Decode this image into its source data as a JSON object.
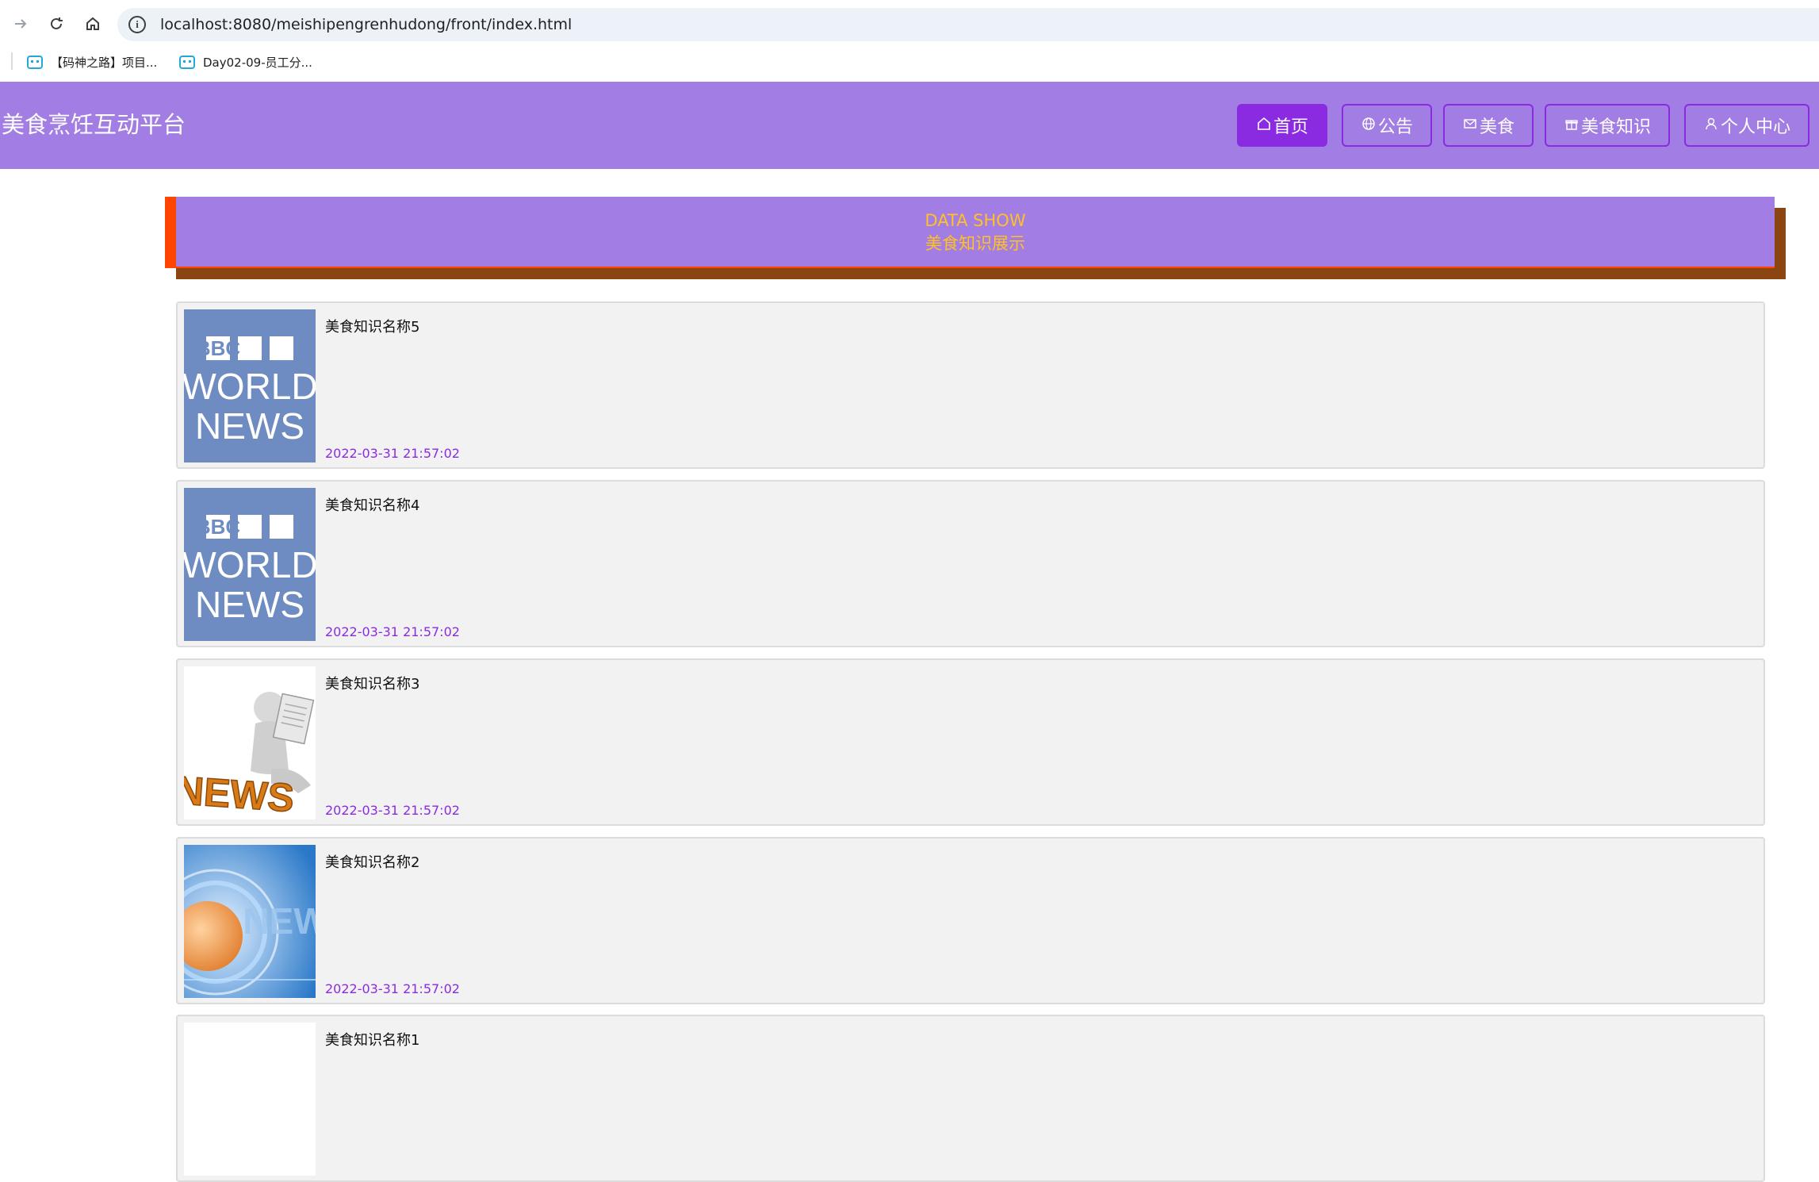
{
  "browser": {
    "url": "localhost:8080/meishipengrenhudong/front/index.html",
    "bookmarks": [
      {
        "label": "【码神之路】项目..."
      },
      {
        "label": "Day02-09-员工分..."
      }
    ]
  },
  "header": {
    "title": "美食烹饪互动平台",
    "nav": [
      {
        "label": "首页",
        "icon": "home-icon"
      },
      {
        "label": "公告",
        "icon": "globe-icon"
      },
      {
        "label": "美食",
        "icon": "mail-icon"
      },
      {
        "label": "美食知识",
        "icon": "gift-icon"
      },
      {
        "label": "个人中心",
        "icon": "user-icon"
      }
    ]
  },
  "banner": {
    "en": "DATA SHOW",
    "cn": "美食知识展示"
  },
  "items": [
    {
      "title": "美食知识名称5",
      "date": "2022-03-31 21:57:02",
      "thumb": "bbc-world-news",
      "thumb_text": [
        "BBC",
        "WORLD",
        "NEWS"
      ]
    },
    {
      "title": "美食知识名称4",
      "date": "2022-03-31 21:57:02",
      "thumb": "bbc-world-news",
      "thumb_text": [
        "BBC",
        "WORLD",
        "NEWS"
      ]
    },
    {
      "title": "美食知识名称3",
      "date": "2022-03-31 21:57:02",
      "thumb": "news-figure",
      "thumb_text": [
        "NEWS"
      ]
    },
    {
      "title": "美食知识名称2",
      "date": "2022-03-31 21:57:02",
      "thumb": "news-globe",
      "thumb_text": [
        "NEW"
      ]
    },
    {
      "title": "美食知识名称1",
      "date": "",
      "thumb": "blank"
    }
  ],
  "colors": {
    "header_bg": "#a27de3",
    "accent": "#8a2be2",
    "banner_text": "#ffc125",
    "banner_left_bar": "#ff4500",
    "banner_shadow": "#8b4513",
    "date_text": "#8a2be2"
  }
}
